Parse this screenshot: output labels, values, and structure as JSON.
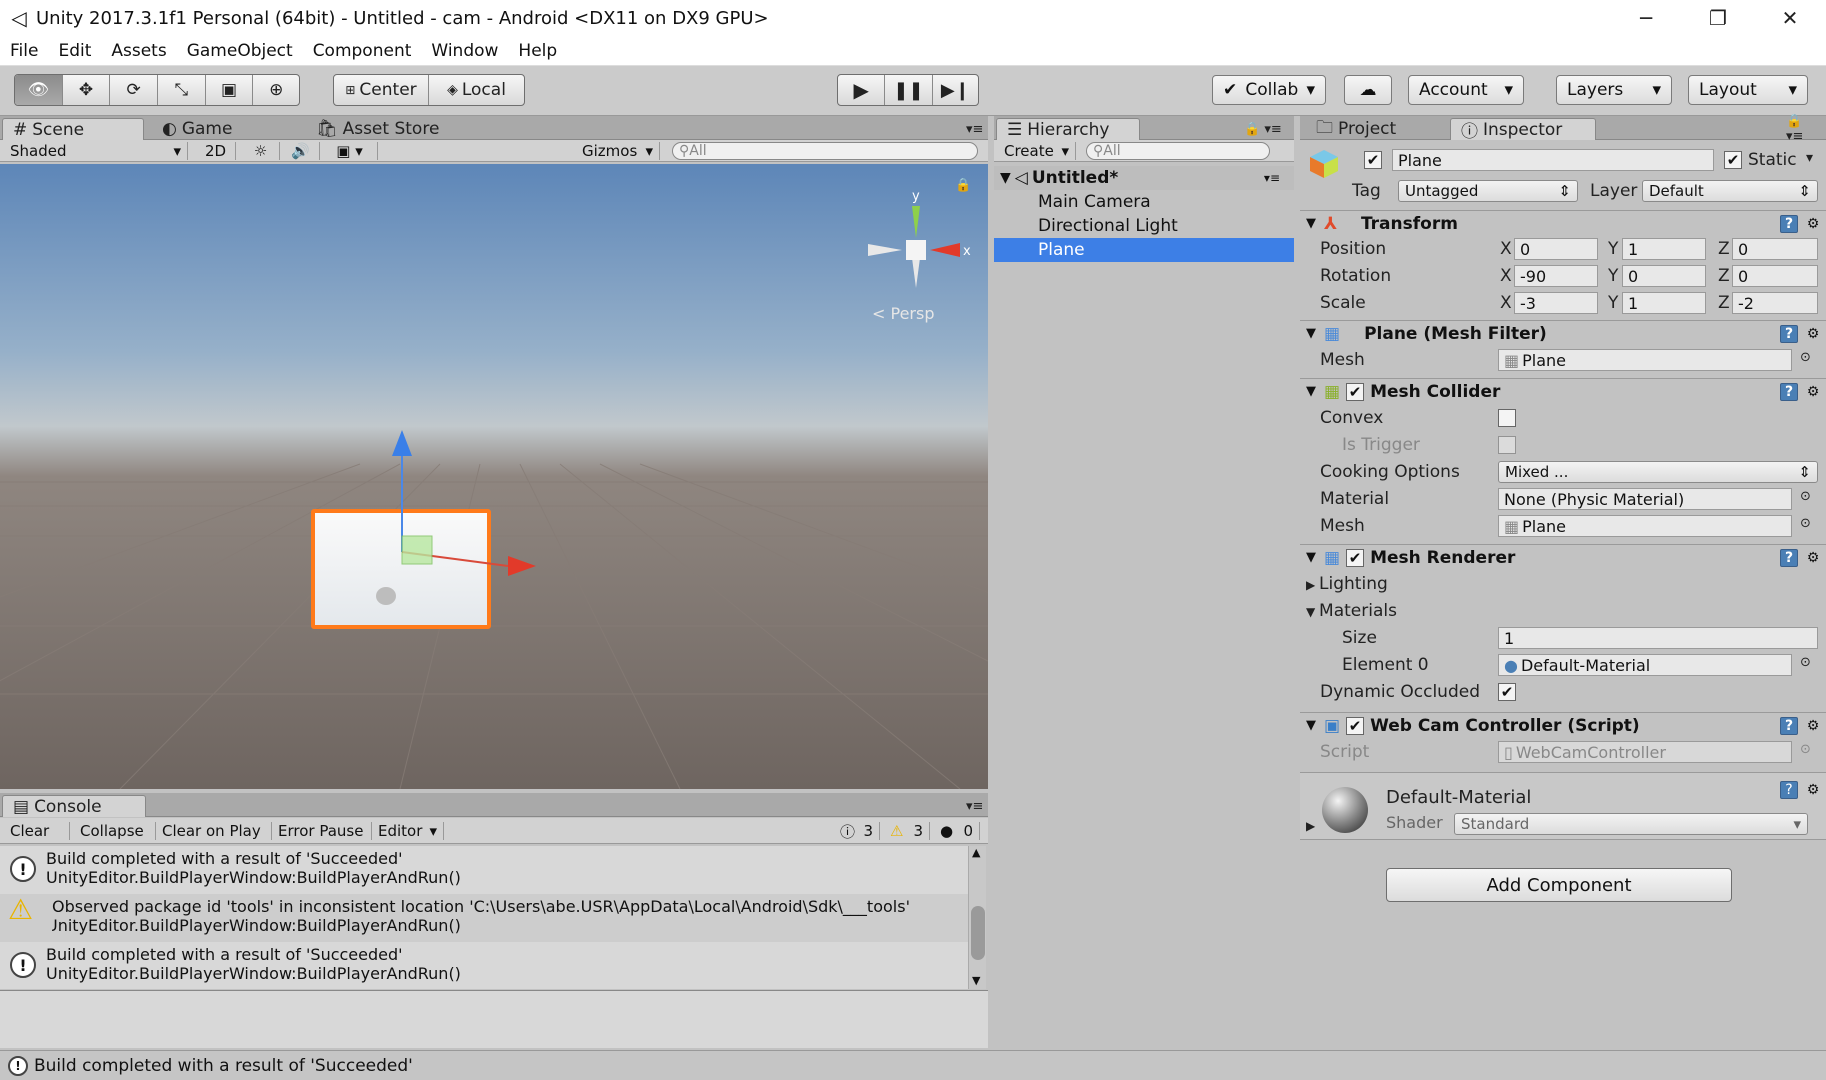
{
  "window": {
    "title": "Unity 2017.3.1f1 Personal (64bit) - Untitled - cam - Android <DX11 on DX9 GPU>",
    "minimize": "─",
    "maximize": "❐",
    "close": "✕"
  },
  "menu": [
    "File",
    "Edit",
    "Assets",
    "GameObject",
    "Component",
    "Window",
    "Help"
  ],
  "toolbar": {
    "pivot": "Center",
    "space": "Local",
    "collab": "Collab",
    "account": "Account",
    "layers": "Layers",
    "layout": "Layout",
    "dropdown_arrow": "▾"
  },
  "scene": {
    "tabs": {
      "scene": "Scene",
      "game": "Game",
      "asset_store": "Asset Store"
    },
    "shading": "Shaded",
    "mode_2d": "2D",
    "gizmos": "Gizmos",
    "search_placeholder": "All",
    "gizmo_label": "Persp",
    "axis_x": "x",
    "axis_y": "y"
  },
  "console": {
    "tab": "Console",
    "buttons": [
      "Clear",
      "Collapse",
      "Clear on Play",
      "Error Pause",
      "Editor"
    ],
    "counts": {
      "info": "3",
      "warning": "3",
      "error": "0"
    },
    "entries": [
      {
        "type": "info",
        "line1": "Build completed with a result of 'Succeeded'",
        "line2": "UnityEditor.BuildPlayerWindow:BuildPlayerAndRun()"
      },
      {
        "type": "warning",
        "line1": "Observed package id 'tools' in inconsistent location 'C:\\Users\\abe.USR\\AppData\\Local\\Android\\Sdk\\___tools'",
        "line2": "UnityEditor.BuildPlayerWindow:BuildPlayerAndRun()"
      },
      {
        "type": "info",
        "line1": "Build completed with a result of 'Succeeded'",
        "line2": "UnityEditor.BuildPlayerWindow:BuildPlayerAndRun()"
      }
    ]
  },
  "hierarchy": {
    "tab": "Hierarchy",
    "create": "Create",
    "search_placeholder": "All",
    "scene": "Untitled*",
    "items": [
      "Main Camera",
      "Directional Light",
      "Plane"
    ],
    "selected": "Plane"
  },
  "project_tab": "Project",
  "inspector": {
    "tab": "Inspector",
    "object_name": "Plane",
    "static_label": "Static",
    "tag_label": "Tag",
    "tag_value": "Untagged",
    "layer_label": "Layer",
    "layer_value": "Default",
    "transform": {
      "title": "Transform",
      "position_label": "Position",
      "rotation_label": "Rotation",
      "scale_label": "Scale",
      "axes": [
        "X",
        "Y",
        "Z"
      ],
      "position": [
        "0",
        "1",
        "0"
      ],
      "rotation": [
        "-90",
        "0",
        "0"
      ],
      "scale": [
        "-3",
        "1",
        "-2"
      ]
    },
    "mesh_filter": {
      "title": "Plane (Mesh Filter)",
      "mesh_label": "Mesh",
      "mesh_value": "Plane"
    },
    "mesh_collider": {
      "title": "Mesh Collider",
      "convex": "Convex",
      "is_trigger": "Is Trigger",
      "cooking_label": "Cooking Options",
      "cooking_value": "Mixed ...",
      "material_label": "Material",
      "material_value": "None (Physic Material)",
      "mesh_label": "Mesh",
      "mesh_value": "Plane"
    },
    "mesh_renderer": {
      "title": "Mesh Renderer",
      "lighting": "Lighting",
      "materials": "Materials",
      "size_label": "Size",
      "size_value": "1",
      "element_label": "Element 0",
      "element_value": "Default-Material",
      "dynamic_label": "Dynamic Occluded"
    },
    "script_comp": {
      "title": "Web Cam Controller (Script)",
      "script_label": "Script",
      "script_value": "WebCamController"
    },
    "material": {
      "name": "Default-Material",
      "shader_label": "Shader",
      "shader_value": "Standard"
    },
    "add_component": "Add Component"
  },
  "status": "Build completed with a result of 'Succeeded'",
  "colors": {
    "selection": "#3d7fe6",
    "orange_outline": "#ff7a1a",
    "accent_blue": "#4a7fb5"
  }
}
